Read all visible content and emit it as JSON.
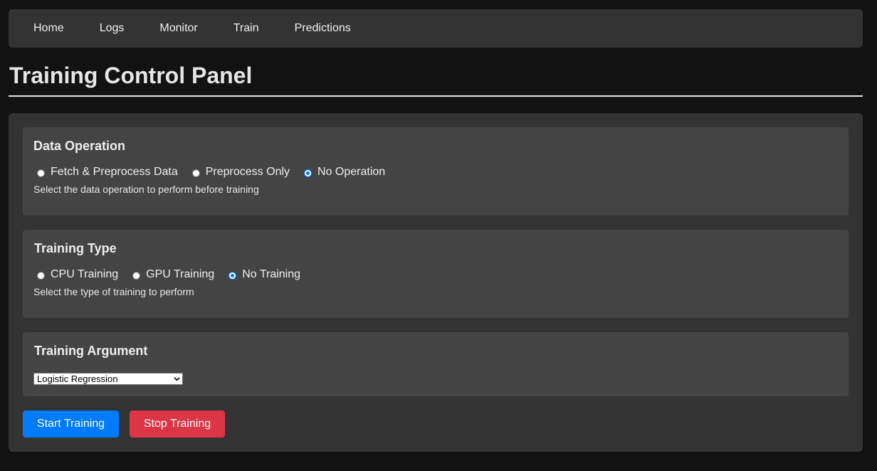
{
  "nav": {
    "items": [
      "Home",
      "Logs",
      "Monitor",
      "Train",
      "Predictions"
    ]
  },
  "page": {
    "title": "Training Control Panel"
  },
  "data_operation": {
    "title": "Data Operation",
    "options": [
      "Fetch & Preprocess Data",
      "Preprocess Only",
      "No Operation"
    ],
    "selected": "No Operation",
    "hint": "Select the data operation to perform before training"
  },
  "training_type": {
    "title": "Training Type",
    "options": [
      "CPU Training",
      "GPU Training",
      "No Training"
    ],
    "selected": "No Training",
    "hint": "Select the type of training to perform"
  },
  "training_argument": {
    "title": "Training Argument",
    "selected_value": "Logistic Regression"
  },
  "buttons": {
    "start": "Start Training",
    "stop": "Stop Training"
  },
  "colors": {
    "primary": "#007bff",
    "danger": "#dc3545",
    "radio_checked": "#0075ff"
  }
}
